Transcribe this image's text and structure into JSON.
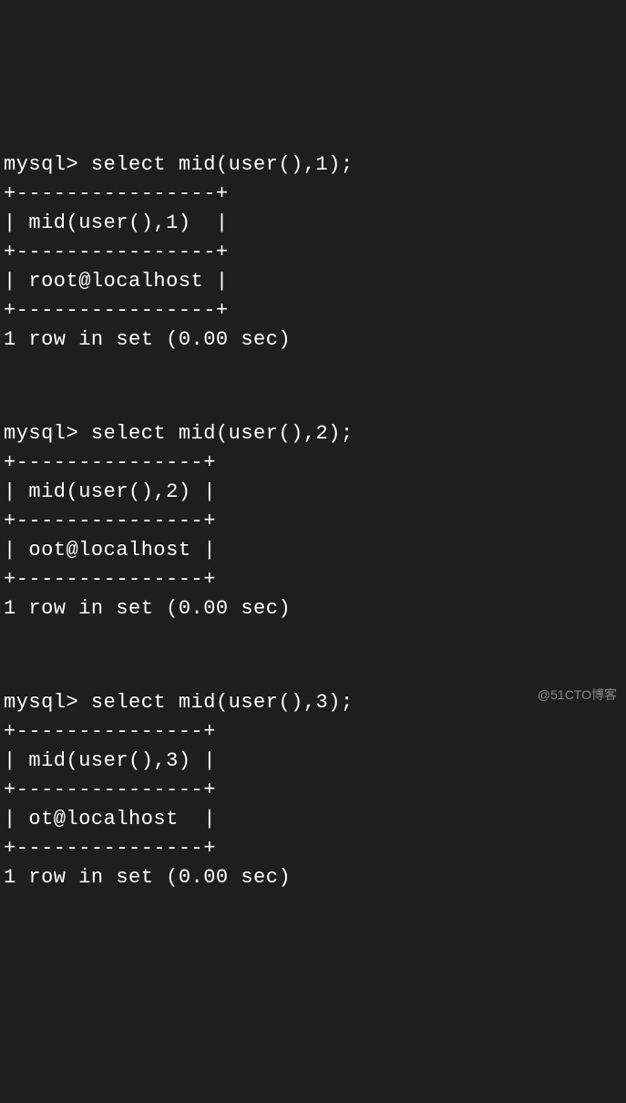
{
  "queries": [
    {
      "prompt": "mysql> ",
      "command": "select mid(user(),1);",
      "border_top": "+----------------+",
      "header_row": "| mid(user(),1)  |",
      "border_mid": "+----------------+",
      "data_row": "| root@localhost |",
      "border_bottom": "+----------------+",
      "status": "1 row in set (0.00 sec)"
    },
    {
      "prompt": "mysql> ",
      "command": "select mid(user(),2);",
      "border_top": "+---------------+",
      "header_row": "| mid(user(),2) |",
      "border_mid": "+---------------+",
      "data_row": "| oot@localhost |",
      "border_bottom": "+---------------+",
      "status": "1 row in set (0.00 sec)"
    },
    {
      "prompt": "mysql> ",
      "command": "select mid(user(),3);",
      "border_top": "+---------------+",
      "header_row": "| mid(user(),3) |",
      "border_mid": "+---------------+",
      "data_row": "| ot@localhost  |",
      "border_bottom": "+---------------+",
      "status": "1 row in set (0.00 sec)"
    }
  ],
  "watermark": "@51CTO博客"
}
